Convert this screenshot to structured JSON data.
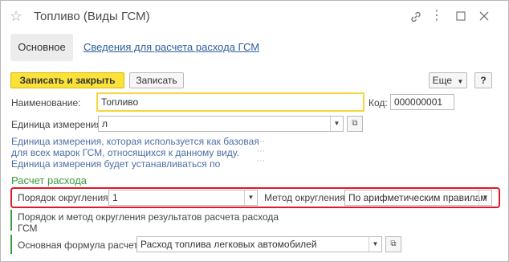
{
  "window": {
    "title": "Топливо (Виды ГСМ)",
    "icons": {
      "favorite": "star-icon",
      "link": "link-icon",
      "more": "more-icon",
      "maximize": "maximize-icon",
      "close": "close-icon"
    }
  },
  "tabs": [
    {
      "label": "Основное",
      "active": true
    },
    {
      "label": "Сведения для расчета расхода ГСМ",
      "active": false
    }
  ],
  "toolbar": {
    "save_close_label": "Записать и закрыть",
    "save_label": "Записать",
    "more_label": "Еще",
    "help_label": "?"
  },
  "form": {
    "name_label": "Наименование:",
    "name_value": "Топливо",
    "code_label": "Код:",
    "code_value": "000000001",
    "unit_label": "Единица измерения:",
    "unit_value": "л",
    "unit_hint": "Единица измерения, которая используется как базовая для всех марок ГСМ, относящихся к данному виду. Единица измерения будет устанавливаться по умолчанию в документ..."
  },
  "calc": {
    "section_title": "Расчет расхода",
    "rounding_order_label": "Порядок округления:",
    "rounding_order_value": "1",
    "rounding_method_label": "Метод округления:",
    "rounding_method_value": "По арифметическим правилам",
    "rounding_note": "Порядок и метод округления результатов расчета расхода ГСМ",
    "formula_label": "Основная формула расчета:",
    "formula_value": "Расход топлива легковых автомобилей"
  },
  "colors": {
    "primary_button": "#fbe23b",
    "focus_border": "#f7d53c",
    "link": "#2f5e9c",
    "section_title": "#3d9a3d",
    "highlight_frame": "#e0182a",
    "hint_text": "#4d6fa5"
  }
}
